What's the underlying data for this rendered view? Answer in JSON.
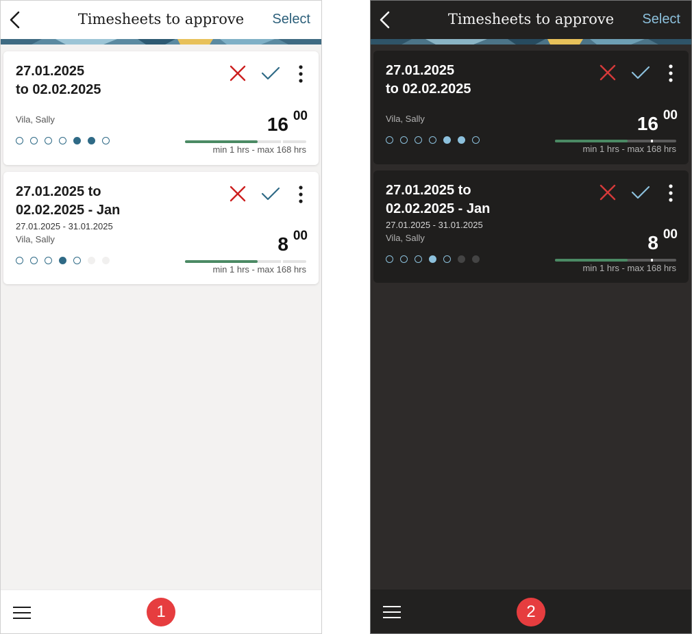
{
  "header": {
    "title": "Timesheets to approve",
    "select_label": "Select"
  },
  "cards": [
    {
      "title_line1": "27.01.2025",
      "title_line2": "to 02.02.2025",
      "subtitle": "",
      "employee": "Vila, Sally",
      "hours": "16",
      "hours_minutes": "00",
      "range": "min 1 hrs - max 168 hrs",
      "progress": 0.6,
      "days": [
        "open",
        "open",
        "open",
        "open",
        "filled",
        "filled",
        "open"
      ]
    },
    {
      "title_line1": "27.01.2025 to",
      "title_line2": "02.02.2025 - Jan",
      "subtitle": "27.01.2025 - 31.01.2025",
      "employee": "Vila, Sally",
      "hours": "8",
      "hours_minutes": "00",
      "range": "min 1 hrs - max 168 hrs",
      "progress": 0.6,
      "days": [
        "open",
        "open",
        "open",
        "filled",
        "open",
        "empty",
        "empty"
      ]
    }
  ],
  "callouts": [
    "1",
    "2"
  ],
  "icons": {
    "back": "chevron-left-icon",
    "reject": "x-icon",
    "approve": "check-icon",
    "more": "more-vertical-icon",
    "menu": "hamburger-icon"
  },
  "colors": {
    "reject": "#cc1f1f",
    "approve_light": "#2f6a86",
    "approve_dark": "#8cc0dc",
    "progress": "#4b8a64",
    "badge": "#e63d3f"
  }
}
